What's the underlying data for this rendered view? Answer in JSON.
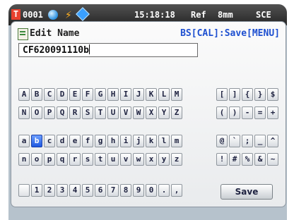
{
  "statusbar": {
    "counter": "0001",
    "time": "15:18:18",
    "mode": "Ref",
    "mm": "8mm",
    "sce": "SCE"
  },
  "dialog": {
    "title": "Edit Name",
    "hint": "BS[CAL]:Save[MENU]",
    "value": "CF620091110b"
  },
  "keyboard": {
    "rows": [
      [
        "A",
        "B",
        "C",
        "D",
        "E",
        "F",
        "G",
        "H",
        "I",
        "J",
        "K",
        "L",
        "M"
      ],
      [
        "N",
        "O",
        "P",
        "Q",
        "R",
        "S",
        "T",
        "U",
        "V",
        "W",
        "X",
        "Y",
        "Z"
      ],
      [
        "a",
        "b",
        "c",
        "d",
        "e",
        "f",
        "g",
        "h",
        "i",
        "j",
        "k",
        "l",
        "m"
      ],
      [
        "n",
        "o",
        "p",
        "q",
        "r",
        "s",
        "t",
        "u",
        "v",
        "w",
        "x",
        "y",
        "z"
      ],
      [
        "",
        "1",
        "2",
        "3",
        "4",
        "5",
        "6",
        "7",
        "8",
        "9",
        "0",
        ".",
        ","
      ]
    ],
    "symbols": [
      [
        "[",
        "]",
        "{",
        "}",
        "$"
      ],
      [
        "(",
        ")",
        "-",
        "=",
        "+"
      ],
      [
        "@",
        "`",
        ";",
        "_",
        "^"
      ],
      [
        "!",
        "#",
        "%",
        "&",
        "~"
      ]
    ],
    "selected": "b",
    "save_label": "Save"
  }
}
